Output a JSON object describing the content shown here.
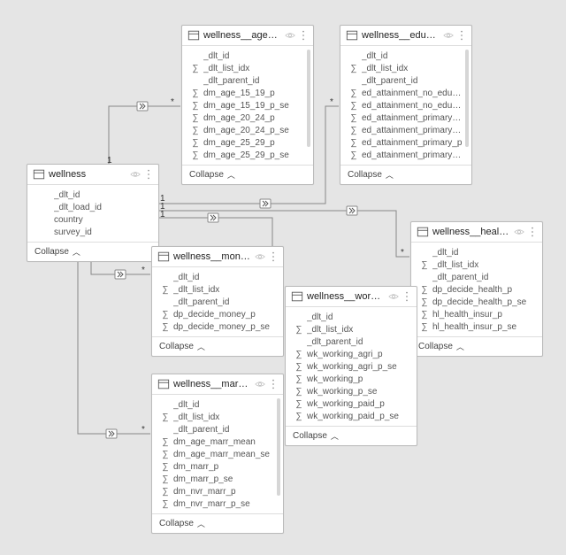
{
  "tables": {
    "wellness": {
      "title": "wellness",
      "fields": [
        {
          "name": "_dlt_id",
          "sigma": false
        },
        {
          "name": "_dlt_load_id",
          "sigma": false
        },
        {
          "name": "country",
          "sigma": false
        },
        {
          "name": "survey_id",
          "sigma": false
        }
      ],
      "collapse": "Collapse"
    },
    "age": {
      "title": "wellness__age_related",
      "fields": [
        {
          "name": "_dlt_id",
          "sigma": false
        },
        {
          "name": "_dlt_list_idx",
          "sigma": true
        },
        {
          "name": "_dlt_parent_id",
          "sigma": false
        },
        {
          "name": "dm_age_15_19_p",
          "sigma": true
        },
        {
          "name": "dm_age_15_19_p_se",
          "sigma": true
        },
        {
          "name": "dm_age_20_24_p",
          "sigma": true
        },
        {
          "name": "dm_age_20_24_p_se",
          "sigma": true
        },
        {
          "name": "dm_age_25_29_p",
          "sigma": true
        },
        {
          "name": "dm_age_25_29_p_se",
          "sigma": true
        }
      ],
      "collapse": "Collapse"
    },
    "education": {
      "title": "wellness__education_...",
      "fields": [
        {
          "name": "_dlt_id",
          "sigma": false
        },
        {
          "name": "_dlt_list_idx",
          "sigma": true
        },
        {
          "name": "_dlt_parent_id",
          "sigma": false
        },
        {
          "name": "ed_attainment_no_educ_p",
          "sigma": true
        },
        {
          "name": "ed_attainment_no_educ_p_se",
          "sigma": true
        },
        {
          "name": "ed_attainment_primary_comple...",
          "sigma": true
        },
        {
          "name": "ed_attainment_primary_comple...",
          "sigma": true
        },
        {
          "name": "ed_attainment_primary_p",
          "sigma": true
        },
        {
          "name": "ed_attainment_primary_p_se",
          "sigma": true
        }
      ],
      "collapse": "Collapse"
    },
    "money": {
      "title": "wellness__money_rela...",
      "fields": [
        {
          "name": "_dlt_id",
          "sigma": false
        },
        {
          "name": "_dlt_list_idx",
          "sigma": true
        },
        {
          "name": "_dlt_parent_id",
          "sigma": false
        },
        {
          "name": "dp_decide_money_p",
          "sigma": true
        },
        {
          "name": "dp_decide_money_p_se",
          "sigma": true
        }
      ],
      "collapse": "Collapse"
    },
    "health": {
      "title": "wellness__health_relat...",
      "fields": [
        {
          "name": "_dlt_id",
          "sigma": false
        },
        {
          "name": "_dlt_list_idx",
          "sigma": true
        },
        {
          "name": "_dlt_parent_id",
          "sigma": false
        },
        {
          "name": "dp_decide_health_p",
          "sigma": true
        },
        {
          "name": "dp_decide_health_p_se",
          "sigma": true
        },
        {
          "name": "hl_health_insur_p",
          "sigma": true
        },
        {
          "name": "hl_health_insur_p_se",
          "sigma": true
        }
      ],
      "collapse": "Collapse"
    },
    "work": {
      "title": "wellness__work_related",
      "fields": [
        {
          "name": "_dlt_id",
          "sigma": false
        },
        {
          "name": "_dlt_list_idx",
          "sigma": true
        },
        {
          "name": "_dlt_parent_id",
          "sigma": false
        },
        {
          "name": "wk_working_agri_p",
          "sigma": true
        },
        {
          "name": "wk_working_agri_p_se",
          "sigma": true
        },
        {
          "name": "wk_working_p",
          "sigma": true
        },
        {
          "name": "wk_working_p_se",
          "sigma": true
        },
        {
          "name": "wk_working_paid_p",
          "sigma": true
        },
        {
          "name": "wk_working_paid_p_se",
          "sigma": true
        }
      ],
      "collapse": "Collapse"
    },
    "marriage": {
      "title": "wellness__marriage_r...",
      "fields": [
        {
          "name": "_dlt_id",
          "sigma": false
        },
        {
          "name": "_dlt_list_idx",
          "sigma": true
        },
        {
          "name": "_dlt_parent_id",
          "sigma": false
        },
        {
          "name": "dm_age_marr_mean",
          "sigma": true
        },
        {
          "name": "dm_age_marr_mean_se",
          "sigma": true
        },
        {
          "name": "dm_marr_p",
          "sigma": true
        },
        {
          "name": "dm_marr_p_se",
          "sigma": true
        },
        {
          "name": "dm_nvr_marr_p",
          "sigma": true
        },
        {
          "name": "dm_nvr_marr_p_se",
          "sigma": true
        }
      ],
      "collapse": "Collapse"
    }
  },
  "relationships": {
    "one_label": "1",
    "many_label": "*"
  }
}
